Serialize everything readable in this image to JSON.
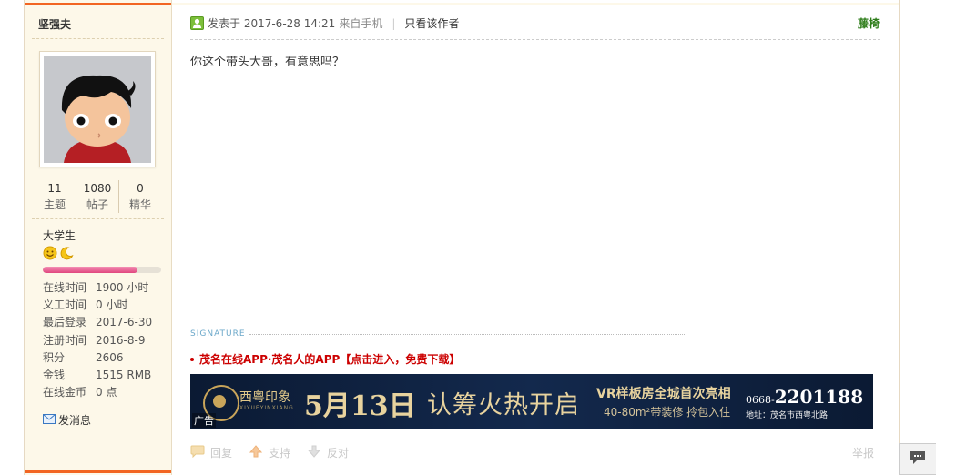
{
  "user": {
    "name": "坚强夫",
    "stats": [
      {
        "num": "11",
        "label": "主题"
      },
      {
        "num": "1080",
        "label": "帖子"
      },
      {
        "num": "0",
        "label": "精华"
      }
    ],
    "rank": "大学生",
    "level_progress": 0.8,
    "info": [
      {
        "key": "在线时间",
        "value": "1900 小时"
      },
      {
        "key": "义工时间",
        "value": "0 小时"
      },
      {
        "key": "最后登录",
        "value": "2017-6-30"
      },
      {
        "key": "注册时间",
        "value": "2016-8-9"
      },
      {
        "key": "积分",
        "value": "2606"
      },
      {
        "key": "金钱",
        "value": "1515 RMB"
      },
      {
        "key": "在线金币",
        "value": "0 点"
      }
    ],
    "pm_label": "发消息"
  },
  "post": {
    "posted_label": "发表于 2017-6-28 14:21",
    "from_label": "来自手机",
    "pipe": "|",
    "only_author_label": "只看该作者",
    "floor_label": "藤椅",
    "content": "你这个带头大哥，有意思吗？",
    "signature_label": "SIGNATURE",
    "app_link": "茂名在线APP·茂名人的APP【点击进入，免费下载】",
    "ad": {
      "tag": "广告",
      "brand": "西粤印象",
      "brand_sub": "XIYUEYINXIANG",
      "date": "5月13日",
      "slogan": "认筹火热开启",
      "vr_line1": "VR样板房全城首次亮相",
      "vr_line2": "40-80m²带装修  拎包入住",
      "phone_prefix": "0668-",
      "phone": "2201188",
      "address": "地址：茂名市西粤北路"
    },
    "actions": {
      "reply": "回复",
      "support": "支持",
      "oppose": "反对",
      "report": "举报"
    }
  }
}
